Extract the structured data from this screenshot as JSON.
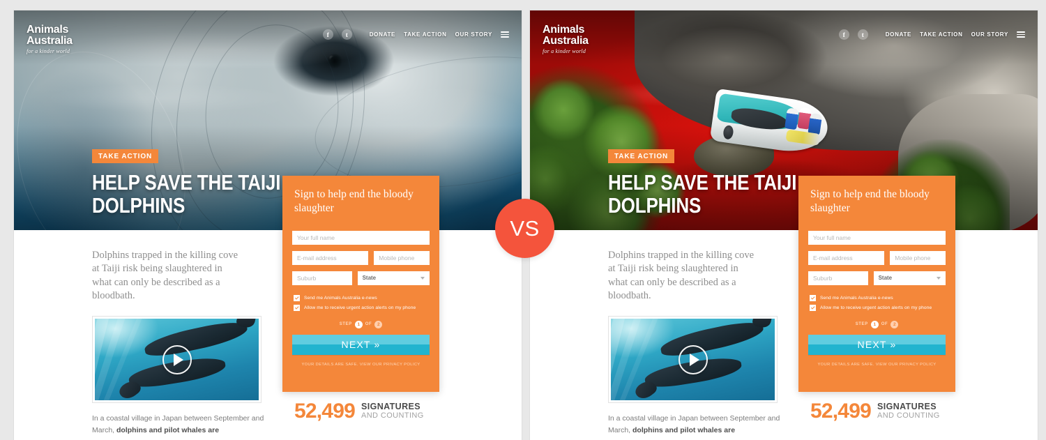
{
  "page": {
    "background_color": "#e8e8e8",
    "vs_label": "VS",
    "vs_color": "#f4543c"
  },
  "brand": {
    "name_line1": "Animals",
    "name_line2": "Australia",
    "tagline": "for a kinder world",
    "accent_orange": "#f4873a",
    "accent_cyan": "#21b4cf"
  },
  "nav": {
    "social": [
      {
        "icon": "facebook-icon",
        "glyph": "f"
      },
      {
        "icon": "twitter-icon",
        "glyph": "t"
      }
    ],
    "links": [
      "DONATE",
      "TAKE ACTION",
      "OUR STORY"
    ],
    "menu_icon": "hamburger-menu-icon"
  },
  "hero": {
    "badge": "TAKE ACTION",
    "title_line1": "HELP SAVE THE TAIJI",
    "title_line2": "DOLPHINS"
  },
  "content": {
    "lead": "Dolphins trapped in the killing cove at Taiji risk being slaughtered in what can only be described as a bloodbath.",
    "bottom_plain": "In a coastal village in Japan between September and March, ",
    "bottom_bold": "dolphins and pilot whales are"
  },
  "video": {
    "play_icon": "play-button-icon",
    "alt": "underwater dolphins swimming"
  },
  "form": {
    "heading": "Sign to help end the bloody slaughter",
    "fields": {
      "full_name_placeholder": "Your full name",
      "email_placeholder": "E-mail address",
      "mobile_placeholder": "Mobile phone",
      "suburb_placeholder": "Suburb",
      "state_value": "State"
    },
    "checkboxes": [
      {
        "label": "Send me Animals Australia e-news",
        "checked": true
      },
      {
        "label": "Allow me to receive urgent action alerts on my phone",
        "checked": true
      }
    ],
    "step": {
      "word": "STEP",
      "current": "1",
      "of": "OF",
      "total": "2"
    },
    "submit_label": "NEXT »",
    "privacy_note": "YOUR DETAILS ARE SAFE.   VIEW OUR PRIVACY POLICY"
  },
  "counter": {
    "number": "52,499",
    "label_main": "SIGNATURES",
    "label_sub": "AND COUNTING"
  },
  "variants": [
    {
      "id": "left",
      "hero_image": "dolphin-closeup-photo"
    },
    {
      "id": "right",
      "hero_image": "bloody-cove-boat-photo"
    }
  ]
}
